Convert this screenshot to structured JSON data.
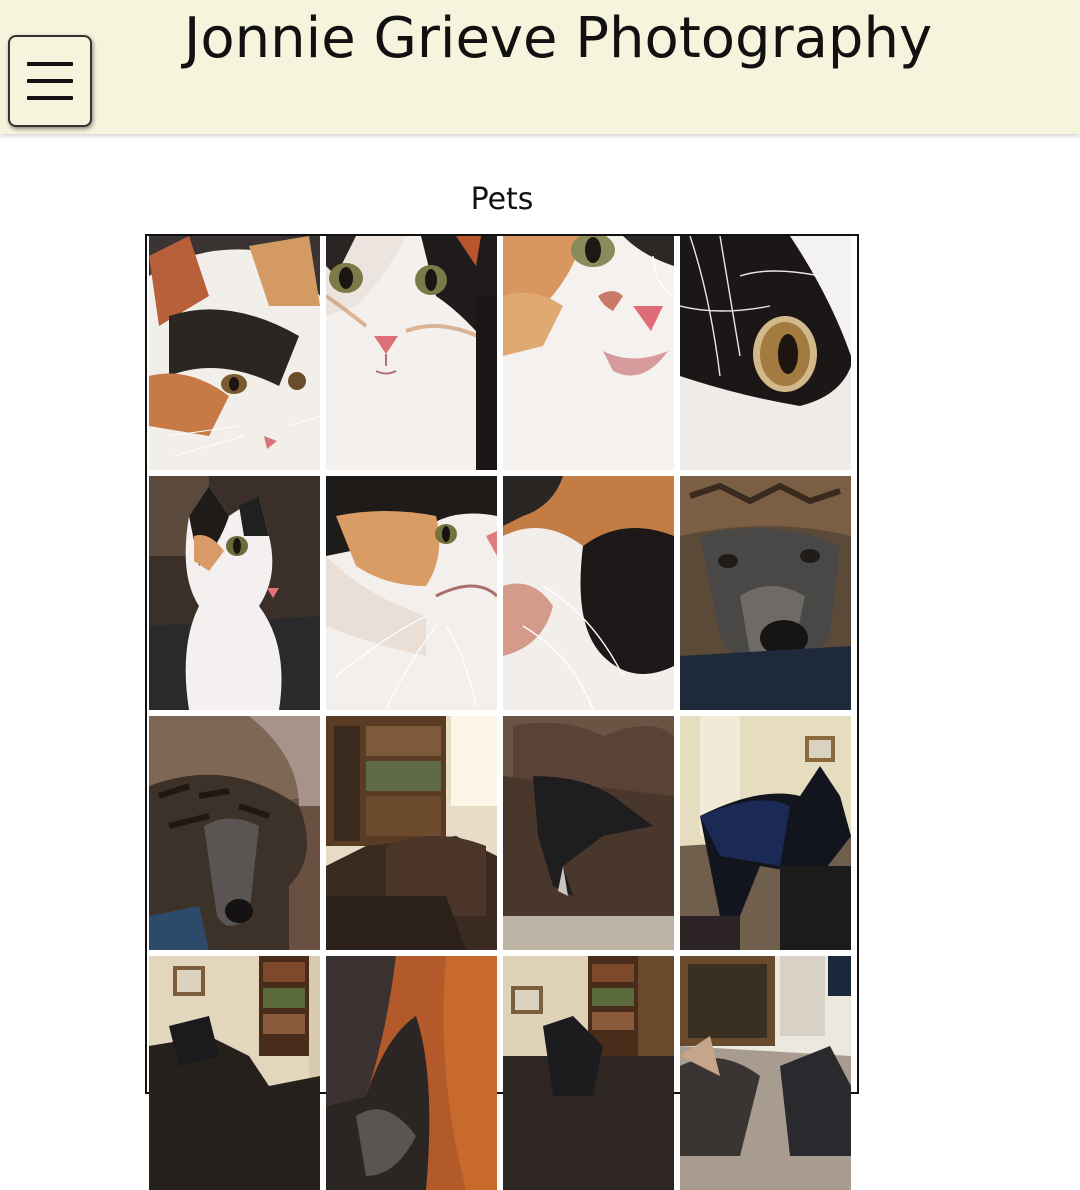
{
  "header": {
    "title": "Jonnie Grieve Photography",
    "menu_icon": "hamburger-icon",
    "background": "#f6f4dc"
  },
  "gallery": {
    "title": "Pets",
    "photos": [
      {
        "name": "photo-calico-kitten-looking-down"
      },
      {
        "name": "photo-kitten-face-front"
      },
      {
        "name": "photo-kitten-face-closeup"
      },
      {
        "name": "photo-cat-eye-closeup"
      },
      {
        "name": "photo-kitten-sitting"
      },
      {
        "name": "photo-kitten-side-profile"
      },
      {
        "name": "photo-calico-fur-closeup"
      },
      {
        "name": "photo-greyhound-under-blanket"
      },
      {
        "name": "photo-greyhound-blanket-sofa"
      },
      {
        "name": "photo-bookshelf-leather-chair"
      },
      {
        "name": "photo-dog-on-leather-sofa"
      },
      {
        "name": "photo-greyhound-in-coat"
      },
      {
        "name": "photo-living-room-bookshelf"
      },
      {
        "name": "photo-dog-fur-closeup"
      },
      {
        "name": "photo-dog-in-living-room"
      },
      {
        "name": "photo-dog-near-cabinet"
      }
    ]
  }
}
